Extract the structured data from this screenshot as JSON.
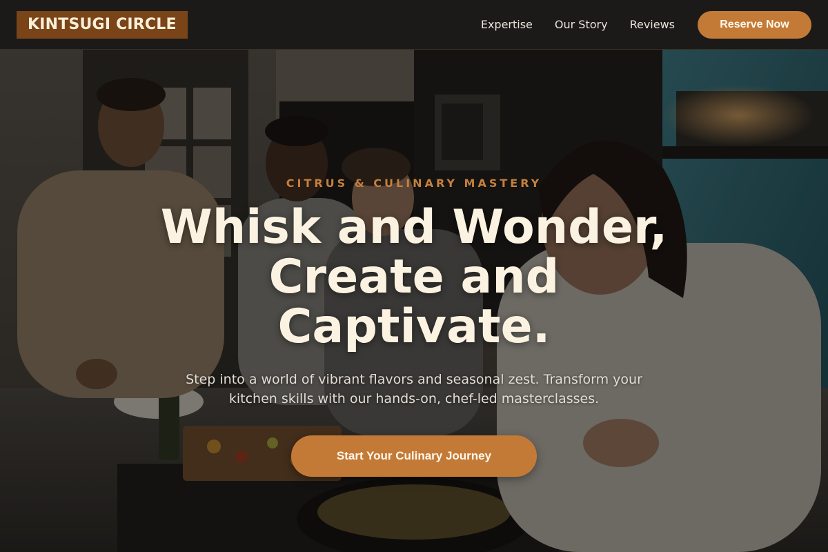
{
  "brand": {
    "name": "KINTSUGI CIRCLE"
  },
  "nav": {
    "links": [
      "Expertise",
      "Our Story",
      "Reviews"
    ],
    "cta_label": "Reserve Now"
  },
  "hero": {
    "eyebrow": "CITRUS & CULINARY MASTERY",
    "headline_lines": [
      "Whisk and Wonder,",
      "Create and",
      "Captivate."
    ],
    "subtext": "Step into a world of vibrant flavors and seasonal zest. Transform your kitchen skills with our hands-on, chef-led masterclasses.",
    "cta_label": "Start Your Culinary Journey",
    "image_description": "photo of four people cooking together in a home kitchen"
  },
  "colors": {
    "accent": "#c47a37",
    "logo_bg": "#7a4419",
    "header_bg": "#1b1a19",
    "headline": "#fbf2e1"
  }
}
